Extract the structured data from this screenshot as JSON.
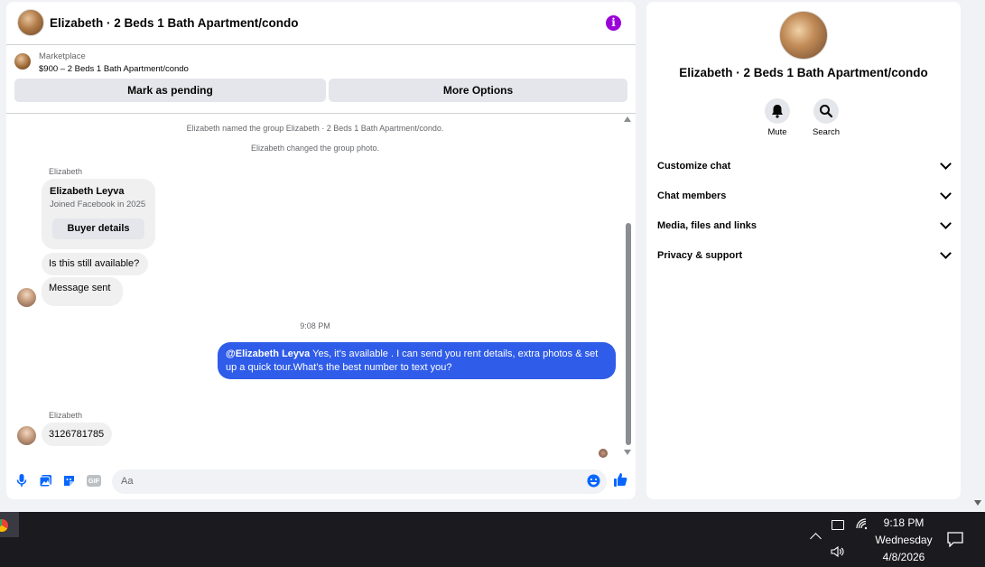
{
  "header": {
    "title": "Elizabeth · 2 Beds 1 Bath Apartment/condo",
    "info_icon": "info-icon",
    "accent": "#9b00d9"
  },
  "listing": {
    "label": "Marketplace",
    "price_title": "$900 – 2 Beds 1 Bath Apartment/condo",
    "mark_pending": "Mark as pending",
    "more_options": "More Options"
  },
  "messages": {
    "sys1": "Elizabeth named the group Elizabeth · 2 Beds 1 Bath Apartment/condo.",
    "sys2": "Elizabeth changed the group photo.",
    "sender1": "Elizabeth",
    "card_name": "Elizabeth Leyva",
    "card_joined": "Joined Facebook in 2025",
    "buyer_details": "Buyer details",
    "msg1": "Is this still available?",
    "msg2": "Message sent",
    "timestamp": "9:08 PM",
    "out_mention": "@Elizabeth Leyva",
    "out_text": " Yes, it’s available .  I can send you rent details, extra photos & set up a quick tour.What’s the best number to text you?",
    "sender2": "Elizabeth",
    "msg3": "3126781785",
    "outgoing_color": "#2f5ce8"
  },
  "composer": {
    "placeholder": "Aa",
    "gif_label": "GIF"
  },
  "info": {
    "title": "Elizabeth · 2 Beds 1 Bath Apartment/condo",
    "mute": "Mute",
    "search": "Search",
    "sections": [
      "Customize chat",
      "Chat members",
      "Media, files and links",
      "Privacy & support"
    ]
  },
  "taskbar": {
    "time": "9:18 PM",
    "day": "Wednesday",
    "date": "4/8/2026"
  }
}
